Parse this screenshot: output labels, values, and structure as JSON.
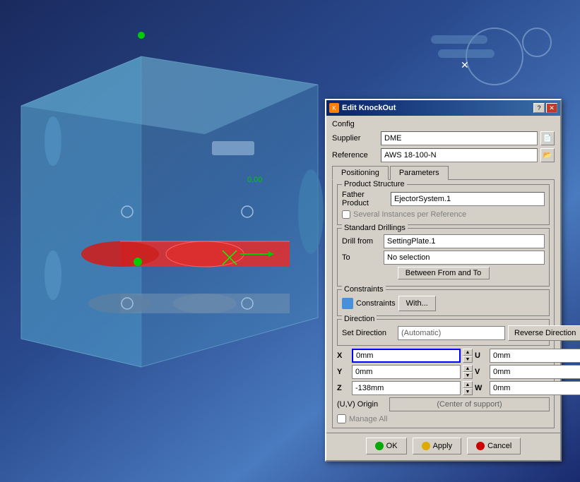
{
  "dialog": {
    "title": "Edit KnockOut",
    "config_label": "Config",
    "supplier_label": "Supplier",
    "supplier_value": "DME",
    "reference_label": "Reference",
    "reference_value": "AWS 18-100-N",
    "tabs": [
      {
        "id": "positioning",
        "label": "Positioning",
        "active": true
      },
      {
        "id": "parameters",
        "label": "Parameters",
        "active": false
      }
    ],
    "product_structure": {
      "title": "Product Structure",
      "father_product_label": "Father Product",
      "father_product_value": "EjectorSystem.1",
      "several_instances_label": "Several Instances per Reference"
    },
    "standard_drillings": {
      "title": "Standard Drillings",
      "drill_from_label": "Drill from",
      "drill_from_value": "SettingPlate.1",
      "to_label": "To",
      "to_value": "No selection",
      "between_btn": "Between From and To"
    },
    "constraints": {
      "title": "Constraints",
      "constraints_label": "Constraints",
      "with_btn": "With..."
    },
    "direction": {
      "title": "Direction",
      "set_direction_label": "Set Direction",
      "set_direction_value": "(Automatic)",
      "reverse_btn": "Reverse Direction"
    },
    "coordinates": {
      "x_label": "X",
      "x_value": "0mm",
      "y_label": "Y",
      "y_value": "0mm",
      "z_label": "Z",
      "z_value": "-138mm",
      "u_label": "U",
      "u_value": "0mm",
      "v_label": "V",
      "v_value": "0mm",
      "w_label": "W",
      "w_value": "0mm"
    },
    "uv_origin_label": "(U,V) Origin",
    "uv_origin_value": "(Center of support)",
    "manage_all_label": "Manage All",
    "buttons": {
      "ok": "OK",
      "apply": "Apply",
      "cancel": "Cancel"
    }
  },
  "icons": {
    "help": "?",
    "close": "✕",
    "up_arrow": "▲",
    "down_arrow": "▼",
    "folder": "📁"
  }
}
